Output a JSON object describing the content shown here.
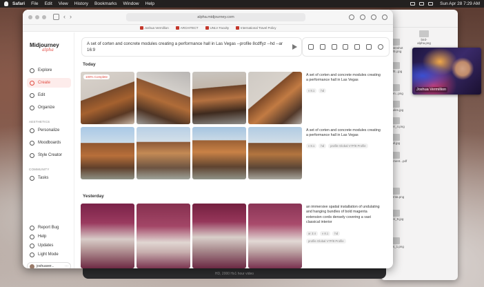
{
  "menubar": {
    "app": "Safari",
    "items": [
      "File",
      "Edit",
      "View",
      "History",
      "Bookmarks",
      "Window",
      "Help"
    ],
    "clock": "Sun Apr 28  7:29 AM"
  },
  "browser": {
    "url": "alpha.midjourney.com",
    "bookmarks": [
      "Joshua Vermillion",
      "ARCHITECT",
      "UNLV Faculty",
      "International Travel Policy"
    ]
  },
  "sidebar": {
    "logo": "Midjourney",
    "logo_sub": "alpha",
    "nav_top": [
      "Explore",
      "Create",
      "Edit",
      "Organize"
    ],
    "section_aesthetics": "AESTHETICS",
    "nav_aesthetics": [
      "Personalize",
      "Moodboards",
      "Style Creator"
    ],
    "section_community": "COMMUNITY",
    "nav_community": [
      "Tasks"
    ],
    "nav_bottom": [
      "Report Bug",
      "Help",
      "Updates",
      "Light Mode"
    ],
    "user": "joshuaver..."
  },
  "prompt": {
    "text": "A set of corten and concrete modules creating a performance hall in Las Vegas --profile 8cdffyz --hd --ar 16:9"
  },
  "feed": {
    "today": "Today",
    "yesterday": "Yesterday",
    "badge": "100% Complete",
    "groups": [
      {
        "desc": "A set of corten and concrete modules creating a performance hall in Las Vegas",
        "tags": [
          "v 8.1",
          "hd"
        ]
      },
      {
        "desc": "A set of corten and concrete modules creating a performance hall in Las Vegas",
        "tags": [
          "v 8.1",
          "hd",
          "profile Global V7P/8 Profile"
        ]
      },
      {
        "desc": "an immersive spatial installation of undulating and hanging bundles of bold magenta extension cords densely covering a vast classical interior",
        "tags": [
          "ar 3:4",
          "v 8.1",
          "hd",
          "profile Global V7P/8 Profile"
        ]
      }
    ]
  },
  "webcam": {
    "name": "Joshua Vermillion"
  },
  "finder": {
    "files": [
      "bird-alpha.png",
      "Screenshot 2025.png",
      "boxfit...jpg",
      "floorplan...pdf",
      "corten...png",
      "modules.jpg",
      "render_4.png",
      "hall.jpg",
      "apartment...pdf",
      "magenta.png",
      "corten_8.jpg",
      "vegas_1.png"
    ]
  },
  "bottombar": {
    "caption": "HD, 2000 Hx1 hour video"
  }
}
